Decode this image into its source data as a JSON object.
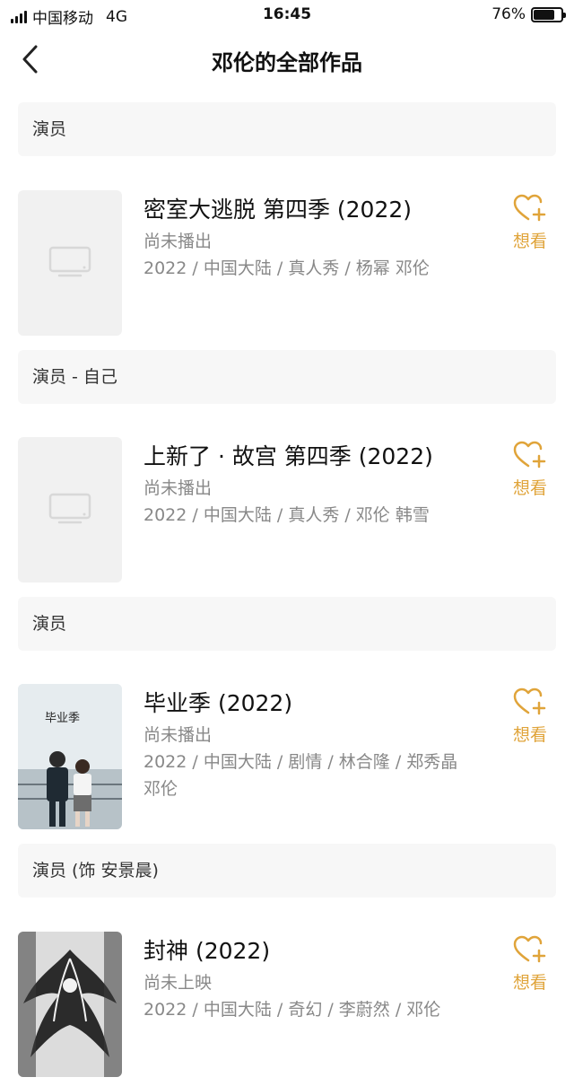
{
  "status_bar": {
    "carrier": "中国移动",
    "network": "4G",
    "time": "16:45",
    "battery": "76%",
    "battery_level": 0.76
  },
  "nav": {
    "title": "邓伦的全部作品"
  },
  "sections": [
    {
      "header": "演员",
      "item": {
        "title": "密室大逃脱 第四季 (2022)",
        "status": "尚未播出",
        "meta_line1": "2022 / 中国大陆 / 真人秀 / 杨幂 邓伦",
        "meta_line2": "",
        "poster": "placeholder-tv-icon",
        "want_label": "想看"
      }
    },
    {
      "header": "演员 - 自己",
      "item": {
        "title": "上新了 · 故宫 第四季 (2022)",
        "status": "尚未播出",
        "meta_line1": "2022 / 中国大陆 / 真人秀 / 邓伦 韩雪",
        "meta_line2": "",
        "poster": "placeholder-tv-icon",
        "want_label": "想看"
      }
    },
    {
      "header": "演员",
      "item": {
        "title": "毕业季 (2022)",
        "status": "尚未播出",
        "meta_line1": "2022 / 中国大陆 / 剧情 / 林合隆 / 郑秀晶",
        "meta_line2": "邓伦",
        "poster": "movie-poster-graduation",
        "poster_text": "毕业季",
        "want_label": "想看"
      }
    },
    {
      "header": "演员 (饰 安景晨)",
      "item": {
        "title": "封神 (2022)",
        "status": "尚未上映",
        "meta_line1": "2022 / 中国大陆 / 奇幻 / 李蔚然 / 邓伦",
        "meta_line2": "",
        "poster": "movie-poster-fengshen",
        "want_label": "想看"
      }
    }
  ],
  "colors": {
    "accent": "#e0a43a",
    "section_bg": "#f7f7f7",
    "secondary_text": "#888888"
  }
}
